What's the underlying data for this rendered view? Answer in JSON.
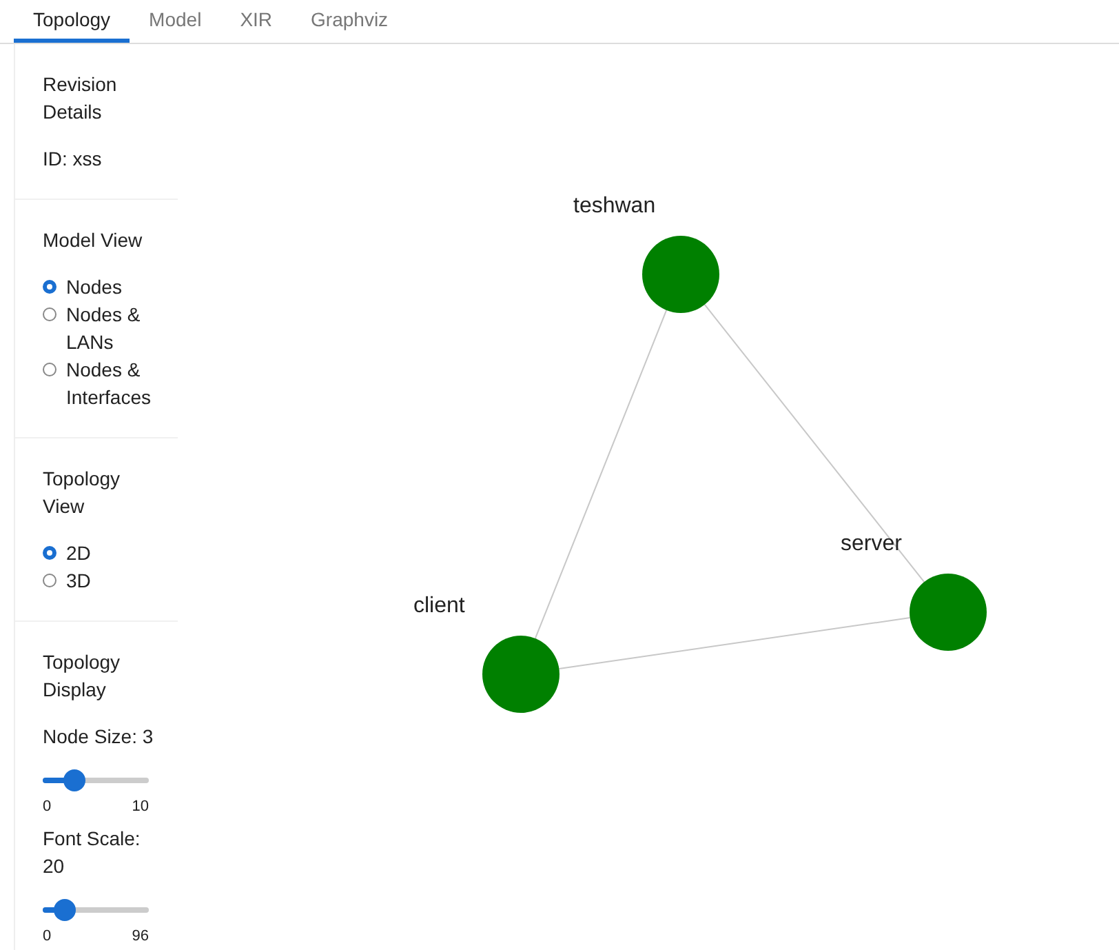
{
  "tabs": [
    {
      "label": "Topology",
      "selected": true
    },
    {
      "label": "Model",
      "selected": false
    },
    {
      "label": "XIR",
      "selected": false
    },
    {
      "label": "Graphviz",
      "selected": false
    }
  ],
  "sidebar": {
    "revision": {
      "title": "Revision Details",
      "id": "ID: xss"
    },
    "model_view": {
      "title": "Model View",
      "options": [
        {
          "label": "Nodes",
          "selected": true
        },
        {
          "label": "Nodes & LANs",
          "selected": false
        },
        {
          "label": "Nodes & Interfaces",
          "selected": false
        }
      ]
    },
    "topology_view": {
      "title": "Topology View",
      "options": [
        {
          "label": "2D",
          "selected": true
        },
        {
          "label": "3D",
          "selected": false
        }
      ]
    },
    "topology_display": {
      "title": "Topology Display",
      "sliders": [
        {
          "label": "Node Size: 3",
          "level": 0.3,
          "min": "0",
          "max": "10"
        },
        {
          "label": "Font Scale: 20",
          "level": 0.21,
          "min": "0",
          "max": "96"
        }
      ]
    }
  },
  "graph": {
    "nodes": [
      {
        "label": "teshwan"
      },
      {
        "label": "server"
      },
      {
        "label": "client"
      }
    ]
  }
}
